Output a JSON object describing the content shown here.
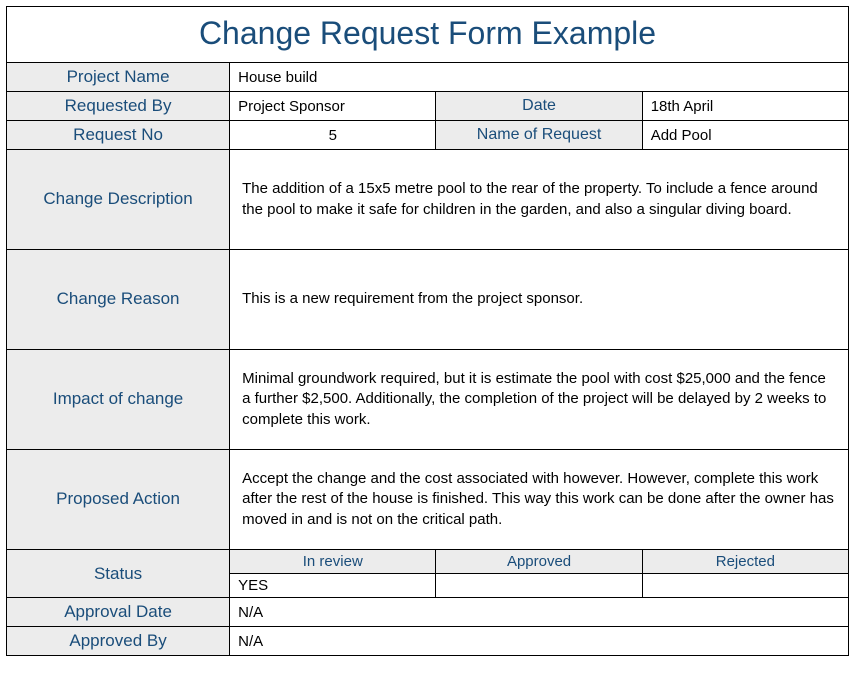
{
  "title": "Change Request Form Example",
  "labels": {
    "project_name": "Project Name",
    "requested_by": "Requested By",
    "date": "Date",
    "request_no": "Request No",
    "name_of_request": "Name of Request",
    "change_description": "Change Description",
    "change_reason": "Change Reason",
    "impact_of_change": "Impact of change",
    "proposed_action": "Proposed Action",
    "status": "Status",
    "approval_date": "Approval Date",
    "approved_by": "Approved By"
  },
  "values": {
    "project_name": "House build",
    "requested_by": "Project Sponsor",
    "date": "18th April",
    "request_no": "5",
    "name_of_request": "Add Pool",
    "change_description": "The addition of a 15x5 metre pool to the rear of the property. To include a fence around the pool to make it safe for children in the garden, and also a singular diving board.",
    "change_reason": "This is a new requirement from the project sponsor.",
    "impact_of_change": "Minimal groundwork required, but it is estimate the pool with cost $25,000 and the fence a further $2,500. Additionally, the completion of the project will be delayed by 2 weeks to complete this work.",
    "proposed_action": "Accept the change and the cost associated with however. However, complete this work after the rest of the house is finished. This way this work can be done after the owner has moved in and is not on the critical path.",
    "approval_date": "N/A",
    "approved_by": "N/A"
  },
  "status": {
    "headers": {
      "in_review": "In review",
      "approved": "Approved",
      "rejected": "Rejected"
    },
    "values": {
      "in_review": "YES",
      "approved": "",
      "rejected": ""
    }
  }
}
